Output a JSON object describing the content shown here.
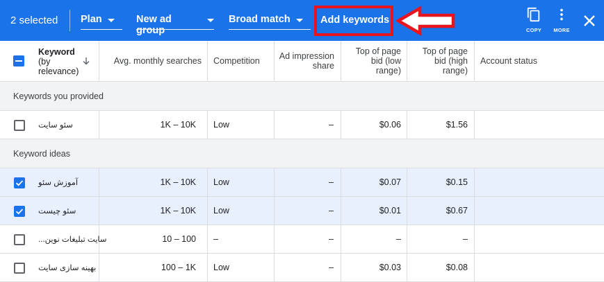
{
  "toolbar": {
    "selected_text": "2 selected",
    "plan_label": "Plan",
    "ad_group_label": "New ad group",
    "match_label": "Broad match",
    "add_keywords_label": "Add keywords",
    "copy_label": "COPY",
    "more_label": "MORE",
    "icons": [
      "copy-icon",
      "more-vert-icon",
      "close-icon"
    ],
    "colors": {
      "bar": "#1a73e8",
      "annotation": "#e8141f"
    }
  },
  "table": {
    "headers": {
      "keyword": [
        "Keyword",
        "(by",
        "relevance)"
      ],
      "avg_searches": "Avg. monthly searches",
      "competition": "Competition",
      "impression_share": [
        "Ad impression",
        "share"
      ],
      "bid_low": [
        "Top of page",
        "bid (low",
        "range)"
      ],
      "bid_high": [
        "Top of page",
        "bid (high",
        "range)"
      ],
      "account_status": "Account status"
    },
    "sections": [
      {
        "title": "Keywords you provided",
        "rows": [
          {
            "checked": false,
            "keyword": "سئو سایت",
            "avg": "1K – 10K",
            "competition": "Low",
            "impression": "–",
            "low": "$0.06",
            "high": "$1.56",
            "status": ""
          }
        ]
      },
      {
        "title": "Keyword ideas",
        "rows": [
          {
            "checked": true,
            "keyword": "آموزش سئو",
            "avg": "1K – 10K",
            "competition": "Low",
            "impression": "–",
            "low": "$0.07",
            "high": "$0.15",
            "status": ""
          },
          {
            "checked": true,
            "keyword": "سئو چیست",
            "avg": "1K – 10K",
            "competition": "Low",
            "impression": "–",
            "low": "$0.01",
            "high": "$0.67",
            "status": ""
          },
          {
            "checked": false,
            "keyword": "سایت تبلیغات نوین...",
            "avg": "10 – 100",
            "competition": "–",
            "impression": "–",
            "low": "–",
            "high": "–",
            "status": ""
          },
          {
            "checked": false,
            "keyword": "بهینه سازی سایت",
            "avg": "100 – 1K",
            "competition": "Low",
            "impression": "–",
            "low": "$0.03",
            "high": "$0.08",
            "status": ""
          }
        ]
      }
    ]
  }
}
